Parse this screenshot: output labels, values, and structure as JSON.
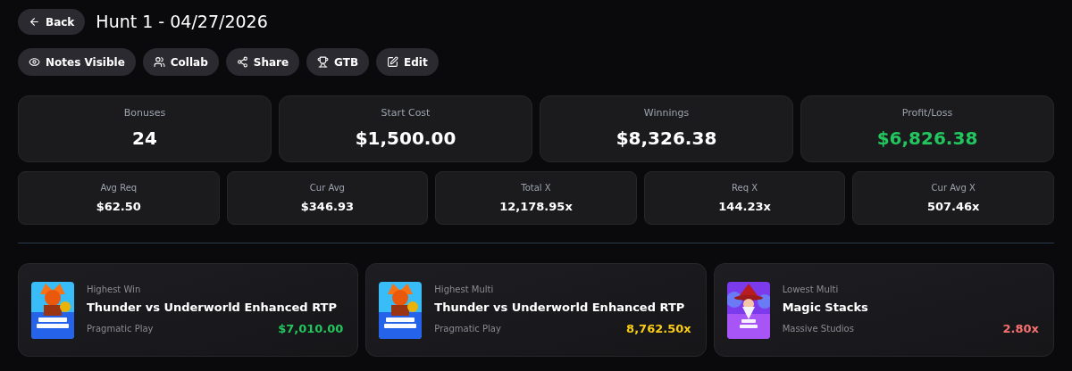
{
  "back_button": "Back",
  "title": "Hunt 1 - 04/27/2026",
  "actions": [
    "Notes Visible",
    "Collab",
    "Share",
    "GTB",
    "Edit"
  ],
  "main_stats": [
    {
      "label": "Bonuses",
      "value": "24",
      "color": "#ffffff"
    },
    {
      "label": "Start Cost",
      "value": "$1,500.00",
      "color": "#ffffff"
    },
    {
      "label": "Winnings",
      "value": "$8,326.38",
      "color": "#ffffff"
    },
    {
      "label": "Profit/Loss",
      "value": "$6,826.38",
      "color": "#22c55e"
    }
  ],
  "sub_stats": [
    {
      "label": "Avg Req",
      "value": "$62.50"
    },
    {
      "label": "Cur Avg",
      "value": "$346.93"
    },
    {
      "label": "Total X",
      "value": "12,178.95x"
    },
    {
      "label": "Req X",
      "value": "144.23x"
    },
    {
      "label": "Cur Avg X",
      "value": "507.46x"
    }
  ],
  "highlights": [
    {
      "caption": "Highest Win",
      "game": "Thunder vs Underworld Enhanced RTP",
      "provider": "Pragmatic Play",
      "value": "$7,010.00",
      "color": "#22c55e"
    },
    {
      "caption": "Highest Multi",
      "game": "Thunder vs Underworld Enhanced RTP",
      "provider": "Pragmatic Play",
      "value": "8,762.50x",
      "color": "#facc15"
    },
    {
      "caption": "Lowest Multi",
      "game": "Magic Stacks",
      "provider": "Massive Studios",
      "value": "2.80x",
      "color": "#f87171"
    }
  ]
}
